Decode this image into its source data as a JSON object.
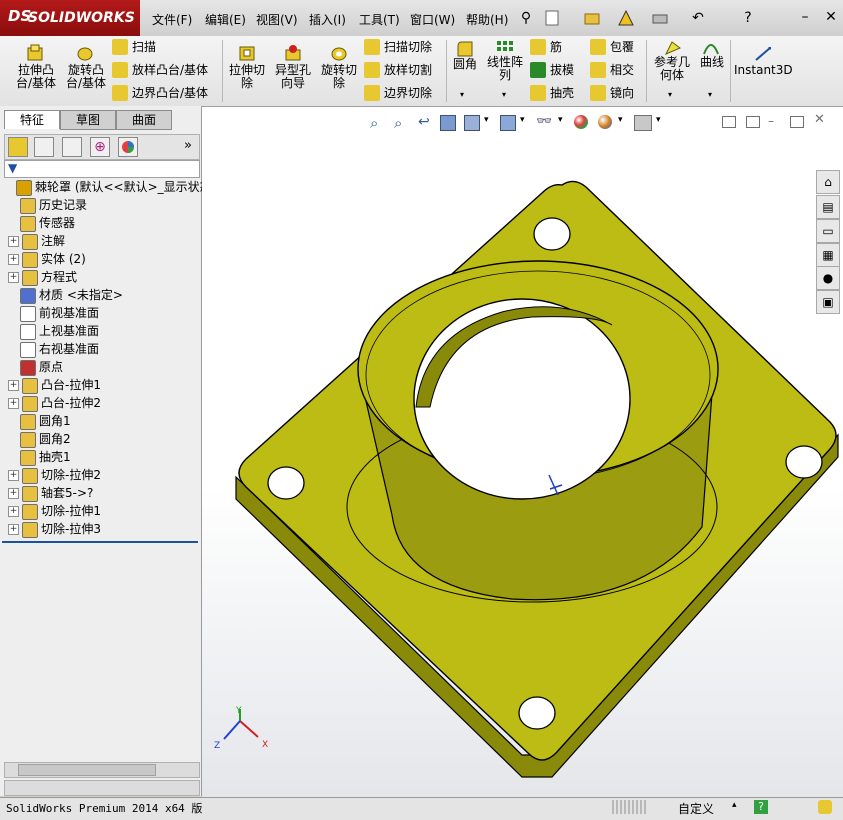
{
  "app": {
    "brand_ds": "DS",
    "brand": "SOLIDWORKS"
  },
  "menu": [
    {
      "label": "文件(F)"
    },
    {
      "label": "编辑(E)"
    },
    {
      "label": "视图(V)"
    },
    {
      "label": "插入(I)"
    },
    {
      "label": "工具(T)"
    },
    {
      "label": "窗口(W)"
    },
    {
      "label": "帮助(H)"
    }
  ],
  "ribbon": {
    "extrude_boss": "拉伸凸\n台/基体",
    "revolve_boss": "旋转凸\n台/基体",
    "sweep": "扫描",
    "loft_boss": "放样凸台/基体",
    "boundary_boss": "边界凸台/基体",
    "extrude_cut": "拉伸切\n除",
    "hole_wizard": "异型孔\n向导",
    "revolve_cut": "旋转切\n除",
    "sweep_cut": "扫描切除",
    "loft_cut": "放样切割",
    "boundary_cut": "边界切除",
    "fillet": "圆角",
    "linear_pattern": "线性阵\n列",
    "rib": "筋",
    "draft": "拔模",
    "shell": "抽壳",
    "wrap": "包覆",
    "intersect": "相交",
    "mirror": "镜向",
    "ref_geometry": "参考几\n何体",
    "curves": "曲线",
    "instant3d": "Instant3D"
  },
  "panel_tabs": [
    {
      "label": "特征"
    },
    {
      "label": "草图"
    },
    {
      "label": "曲面"
    }
  ],
  "tree": [
    {
      "label": "棘轮罩  (默认<<默认>_显示状态",
      "indent": 0,
      "expander": "",
      "color": "#d8a000"
    },
    {
      "label": "历史记录",
      "indent": 1,
      "expander": "",
      "color": "#e8c040"
    },
    {
      "label": "传感器",
      "indent": 1,
      "expander": "",
      "color": "#e8c040"
    },
    {
      "label": "注解",
      "indent": 1,
      "expander": "+",
      "color": "#e8c040"
    },
    {
      "label": "实体 (2)",
      "indent": 1,
      "expander": "+",
      "color": "#e8c040"
    },
    {
      "label": "方程式",
      "indent": 1,
      "expander": "+",
      "color": "#e8c040"
    },
    {
      "label": "材质 <未指定>",
      "indent": 1,
      "expander": "",
      "color": "#5070d0"
    },
    {
      "label": "前视基准面",
      "indent": 1,
      "expander": "",
      "color": "#ffffff"
    },
    {
      "label": "上视基准面",
      "indent": 1,
      "expander": "",
      "color": "#ffffff"
    },
    {
      "label": "右视基准面",
      "indent": 1,
      "expander": "",
      "color": "#ffffff"
    },
    {
      "label": "原点",
      "indent": 1,
      "expander": "",
      "color": "#c03030"
    },
    {
      "label": "凸台-拉伸1",
      "indent": 1,
      "expander": "+",
      "color": "#e8c040"
    },
    {
      "label": "凸台-拉伸2",
      "indent": 1,
      "expander": "+",
      "color": "#e8c040"
    },
    {
      "label": "圆角1",
      "indent": 1,
      "expander": "",
      "color": "#e8c040"
    },
    {
      "label": "圆角2",
      "indent": 1,
      "expander": "",
      "color": "#e8c040"
    },
    {
      "label": "抽壳1",
      "indent": 1,
      "expander": "",
      "color": "#e8c040"
    },
    {
      "label": "切除-拉伸2",
      "indent": 1,
      "expander": "+",
      "color": "#e8c040"
    },
    {
      "label": "轴套5->?",
      "indent": 1,
      "expander": "+",
      "color": "#e8c040"
    },
    {
      "label": "切除-拉伸1",
      "indent": 1,
      "expander": "+",
      "color": "#e8c040"
    },
    {
      "label": "切除-拉伸3",
      "indent": 1,
      "expander": "+",
      "color": "#e8c040"
    }
  ],
  "status": {
    "product": "SolidWorks Premium 2014 x64 版",
    "custom": "自定义"
  },
  "colors": {
    "part_fill": "#bcbc14",
    "part_dark": "#8a8a0a",
    "part_edge": "#000000",
    "accent": "#1c50a0"
  },
  "triad": {
    "x": "X",
    "y": "Y",
    "z": "Z"
  }
}
